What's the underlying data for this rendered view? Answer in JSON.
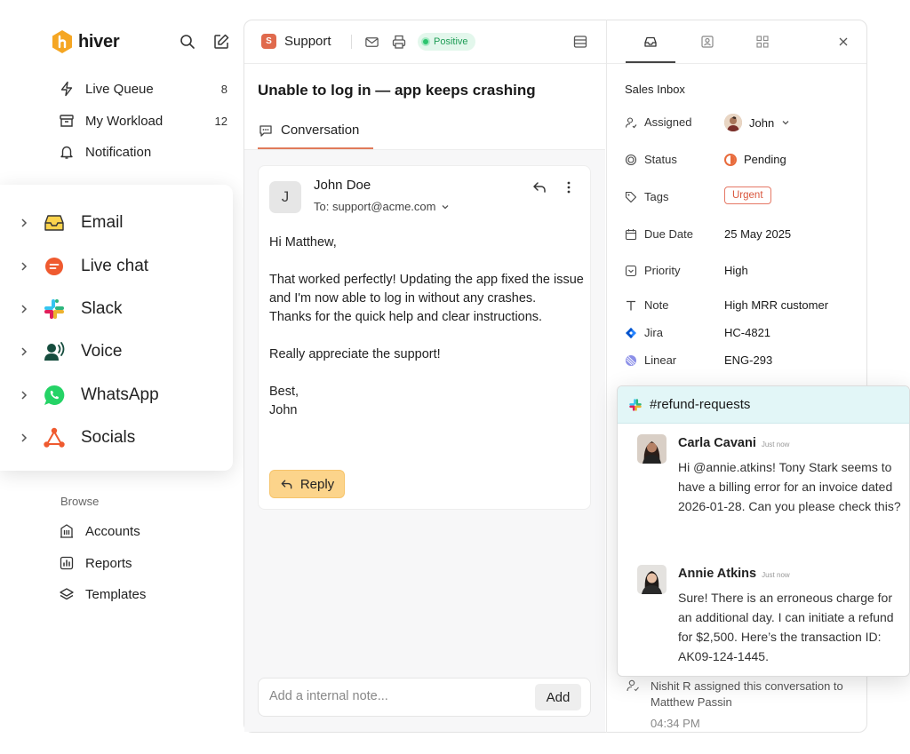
{
  "brand": {
    "name": "hiver",
    "accent": "#f5a623"
  },
  "sidebar": {
    "nav": [
      {
        "label": "Live Queue",
        "count": "8",
        "icon": "bolt-icon"
      },
      {
        "label": "My Workload",
        "count": "12",
        "icon": "archive-icon"
      },
      {
        "label": "Notification",
        "count": "",
        "icon": "bell-icon"
      }
    ],
    "channels": [
      {
        "label": "Email",
        "icon": "email-inbox-icon"
      },
      {
        "label": "Live chat",
        "icon": "live-chat-icon"
      },
      {
        "label": "Slack",
        "icon": "slack-icon"
      },
      {
        "label": "Voice",
        "icon": "voice-icon"
      },
      {
        "label": "WhatsApp",
        "icon": "whatsapp-icon"
      },
      {
        "label": "Socials",
        "icon": "socials-icon"
      }
    ],
    "browse_label": "Browse",
    "browse": [
      {
        "label": "Accounts",
        "icon": "building-icon"
      },
      {
        "label": "Reports",
        "icon": "chart-icon"
      },
      {
        "label": "Templates",
        "icon": "layers-icon"
      }
    ]
  },
  "header": {
    "mailbox_badge": "S",
    "mailbox": "Support",
    "sentiment": "Positive"
  },
  "conversation": {
    "subject": "Unable to log in — app keeps crashing",
    "tab": "Conversation",
    "email": {
      "avatar_letter": "J",
      "from": "John Doe",
      "to": "To: support@acme.com",
      "body": {
        "greeting": "Hi Matthew,",
        "p1": "That worked perfectly! Updating the app fixed the issue and I'm now able to log in without any crashes.",
        "p2": "Thanks for the quick help and clear instructions.",
        "p3": "Really appreciate the support!",
        "signoff": "Best,",
        "signature": "John"
      },
      "reply_label": "Reply"
    },
    "note_placeholder": "Add a internal note...",
    "add_label": "Add"
  },
  "details": {
    "inbox": "Sales Inbox",
    "assigned_label": "Assigned",
    "assigned_value": "John",
    "status_label": "Status",
    "status_value": "Pending",
    "tags_label": "Tags",
    "tag_value": "Urgent",
    "due_label": "Due Date",
    "due_value": "25 May 2025",
    "priority_label": "Priority",
    "priority_value": "High",
    "note_label": "Note",
    "note_value": "High MRR customer",
    "jira_label": "Jira",
    "jira_value": "HC-4821",
    "linear_label": "Linear",
    "linear_value": "ENG-293",
    "activity_text": "Nishit R assigned this conversation to Matthew Passin",
    "activity_time": "04:34 PM"
  },
  "slack": {
    "channel": "#refund-requests",
    "messages": [
      {
        "name": "Carla Cavani",
        "time": "Just now",
        "text": "Hi @annie.atkins! Tony Stark seems to have a billing error for an invoice dated 2026-01-28. Can you please check this?"
      },
      {
        "name": "Annie Atkins",
        "time": "Just now",
        "text": "Sure! There is an erroneous charge for an additional day. I can initiate a refund for $2,500. Here’s the transaction ID: AK09-124-1445."
      }
    ]
  }
}
